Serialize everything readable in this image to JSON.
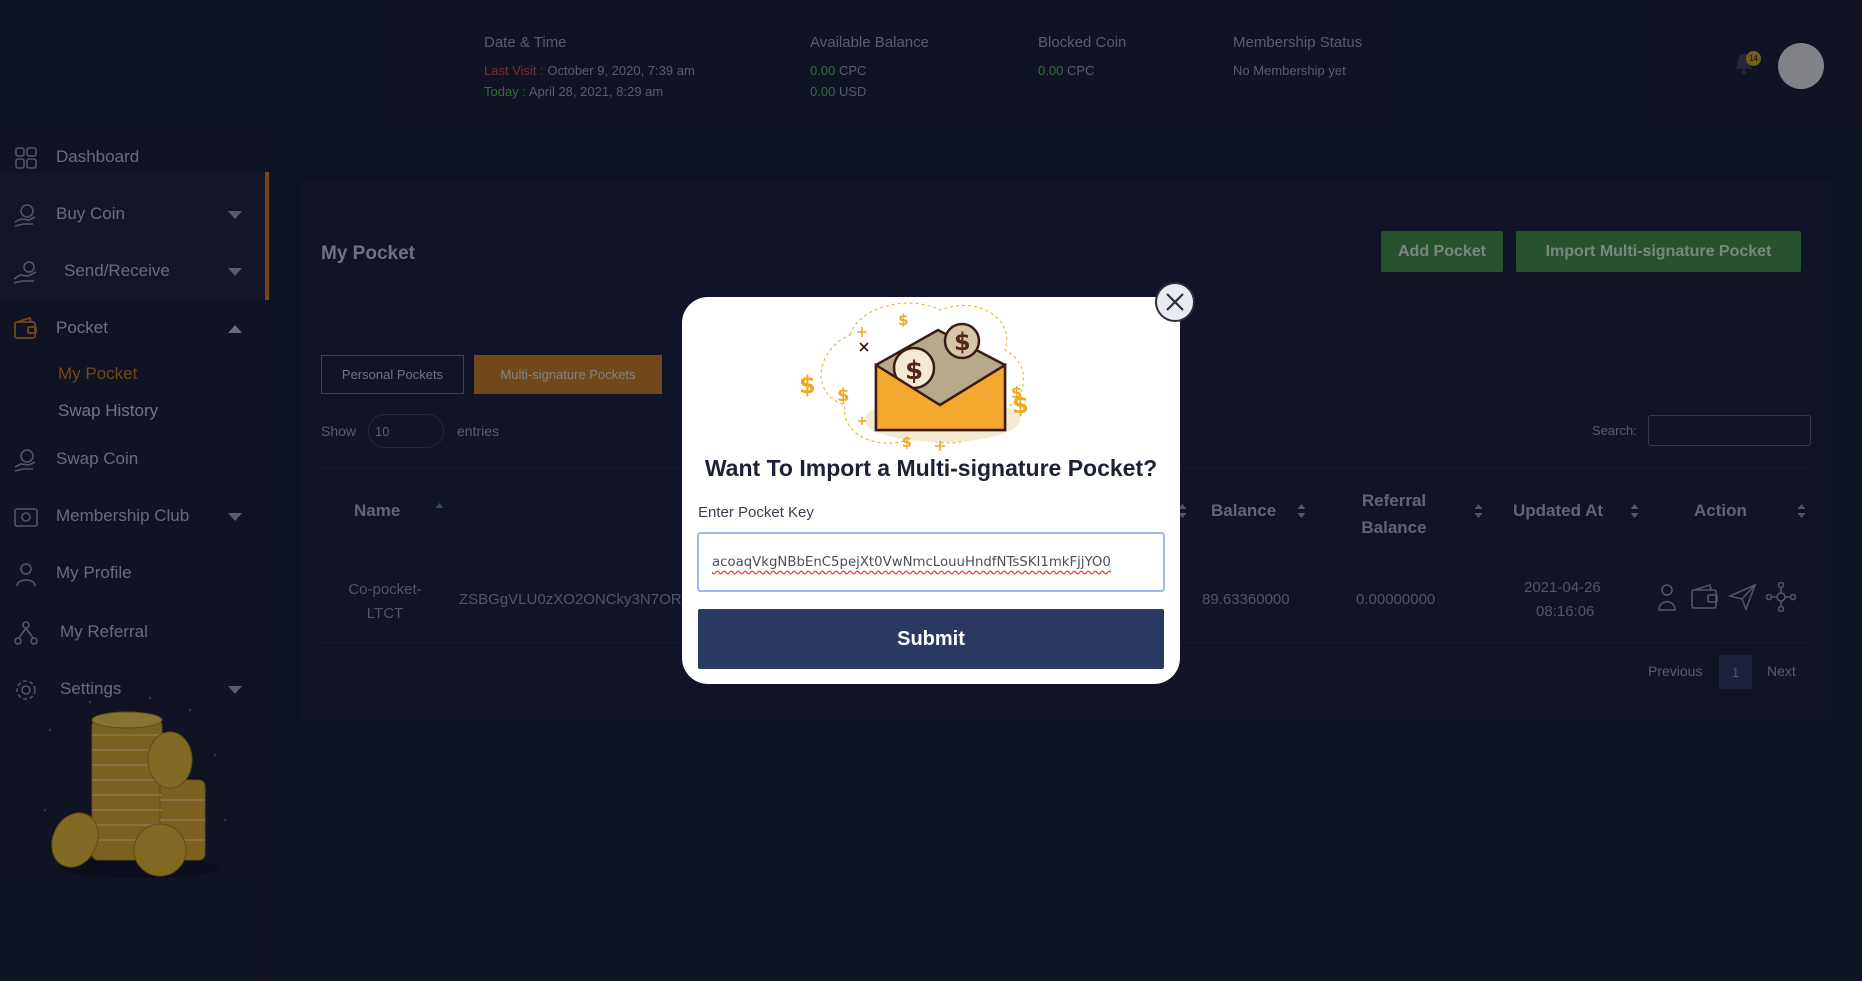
{
  "header": {
    "date_time": {
      "title": "Date & Time",
      "last_visit_label": "Last Visit :",
      "last_visit_value": "October 9, 2020, 7:39 am",
      "today_label": "Today :",
      "today_value": "April 28, 2021, 8:29 am"
    },
    "available_balance": {
      "title": "Available Balance",
      "cpc_amount": "0.00",
      "cpc_unit": "CPC",
      "usd_amount": "0.00",
      "usd_unit": "USD"
    },
    "blocked_coin": {
      "title": "Blocked Coin",
      "amount": "0.00",
      "unit": "CPC"
    },
    "membership": {
      "title": "Membership Status",
      "value": "No Membership yet"
    },
    "notification_count": "14"
  },
  "sidebar": {
    "items": [
      {
        "label": "Dashboard",
        "icon": "dashboard-icon"
      },
      {
        "label": "Buy Coin",
        "icon": "buy-coin-icon"
      },
      {
        "label": "Send/Receive",
        "icon": "send-receive-icon"
      },
      {
        "label": "Pocket",
        "icon": "wallet-icon"
      },
      {
        "label": "Swap Coin",
        "icon": "swap-coin-icon"
      },
      {
        "label": "Membership Club",
        "icon": "membership-icon"
      },
      {
        "label": "My Profile",
        "icon": "user-icon"
      },
      {
        "label": "My Referral",
        "icon": "referral-icon"
      },
      {
        "label": "Settings",
        "icon": "gear-icon"
      }
    ],
    "pocket_sub": [
      "My Pocket",
      "Swap History"
    ]
  },
  "main": {
    "title": "My Pocket",
    "add_pocket": "Add Pocket",
    "import_multisig": "Import Multi-signature Pocket",
    "tabs": [
      "Personal Pockets",
      "Multi-signature Pockets"
    ],
    "show_label": "Show",
    "entries_value": "10",
    "entries_label": "entries",
    "search_label": "Search:",
    "columns": [
      "Name",
      "Balance",
      "Referral Balance",
      "Updated At",
      "Action"
    ],
    "rows": [
      {
        "name": "Co-pocket-LTCT",
        "address": "ZSBGgVLU0zXO2ONCky3N7OR",
        "balance": "89.63360000",
        "referral_balance": "0.00000000",
        "updated_date": "2021-04-26",
        "updated_time": "08:16:06"
      }
    ],
    "pagination": {
      "previous": "Previous",
      "page": "1",
      "next": "Next"
    }
  },
  "modal": {
    "title": "Want To Import a Multi-signature Pocket?",
    "key_label": "Enter Pocket Key",
    "key_value": "acoaqVkgNBbEnC5pejXt0VwNmcLouuHndfNTsSKI1mkFjjYO0",
    "submit": "Submit"
  },
  "colors": {
    "background": "#131a30",
    "accent_orange": "#c77b22",
    "button_green": "#3f8f43",
    "submit_navy": "#2b3a62"
  }
}
